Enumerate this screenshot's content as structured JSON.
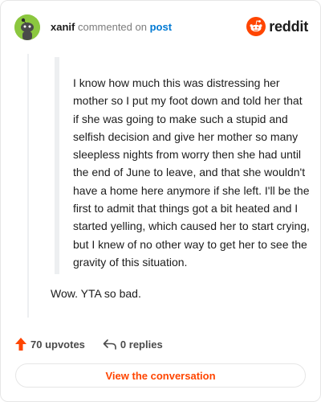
{
  "comment": {
    "author": "xanif",
    "action_text": "commented on",
    "target_link": "post",
    "quote": "I know how much this was distressing her mother so I put my foot down and told her that if she was going to make such a stupid and selfish decision and give her mother so many sleepless nights from worry then she had until the end of June to leave, and that she wouldn't have a home here anymore if she left. I'll be the first to admit that things got a bit heated and I started yelling, which caused her to start crying, but I knew of no other way to get her to see the gravity of this situation.",
    "body": "Wow. YTA so bad."
  },
  "logo": {
    "wordmark": "reddit",
    "icon": "reddit-snoo-icon"
  },
  "actions": {
    "upvotes": "70 upvotes",
    "upvote_icon": "upvote-arrow-icon",
    "replies": "0 replies",
    "reply_icon": "reply-arrow-icon"
  },
  "cta": {
    "label": "View the conversation"
  },
  "colors": {
    "accent": "#ff4500",
    "link": "#0079d3",
    "avatar_bg": "#8bc73f",
    "quote_bar": "#edeff1"
  }
}
